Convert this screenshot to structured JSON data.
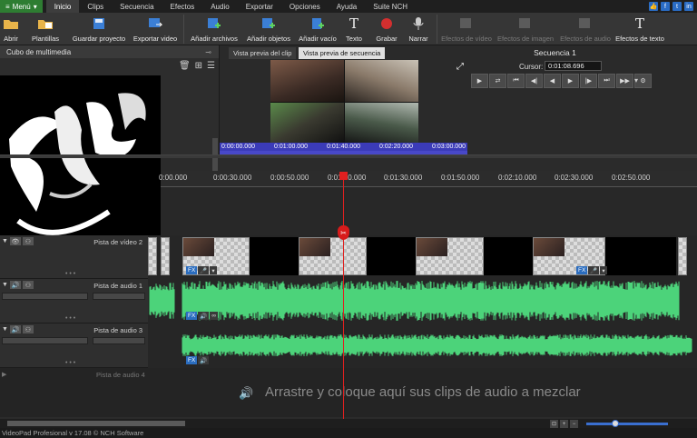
{
  "menubar": {
    "menu_label": "Menú",
    "tabs": [
      {
        "label": "Inicio"
      },
      {
        "label": "Clips"
      },
      {
        "label": "Secuencia"
      },
      {
        "label": "Efectos"
      },
      {
        "label": "Audio"
      },
      {
        "label": "Exportar"
      },
      {
        "label": "Opciones"
      },
      {
        "label": "Ayuda"
      },
      {
        "label": "Suite NCH"
      }
    ],
    "active_tab": "Inicio",
    "social": [
      "like-icon",
      "facebook-icon",
      "twitter-icon",
      "linkedin-icon"
    ]
  },
  "toolbar": {
    "abrir": "Abrir",
    "plantillas": "Plantillas",
    "guardar": "Guardar proyecto",
    "exportar": "Exportar video",
    "anadir_archivos": "Añadir archivos",
    "anadir_objetos": "Añadir objetos",
    "anadir_vacio": "Añadir vacío",
    "texto": "Texto",
    "grabar": "Grabar",
    "narrar": "Narrar",
    "efectos_video": "Efectos de vídeo",
    "efectos_imagen": "Efectos de imagen",
    "efectos_audio": "Efectos de audio",
    "efectos_texto": "Efectos de texto"
  },
  "bin": {
    "title": "Cubo de multimedia"
  },
  "preview": {
    "tab_clip": "Vista previa del clip",
    "tab_seq": "Vista previa de secuencia",
    "ruler": [
      "0:00:00.000",
      "0:01:00.000",
      "0:01:40.000",
      "0:02:20.000",
      "0:03:00.000"
    ]
  },
  "sequence": {
    "title": "Secuencia 1",
    "cursor_label": "Cursor:",
    "cursor_value": "0:01:08.696"
  },
  "timeline": {
    "ticks": [
      "0:00.000",
      "0:00:30.000",
      "0:00:50.000",
      "0:01:10.000",
      "0:01:30.000",
      "0:01:50.000",
      "0:02:10.000",
      "0:02:30.000",
      "0:02:50.000"
    ],
    "tracks": {
      "video2": "Pista de vídeo 2",
      "audio1": "Pista de audio 1",
      "audio3": "Pista de audio 3",
      "audio4": "Pista de audio 4"
    },
    "fx_label": "FX",
    "drop_hint": "Arrastre y coloque aquí sus clips de audio a mezclar",
    "wave_color": "#4cd37a"
  },
  "status": {
    "text": "VideoPad Profesional v 17.08 © NCH Software"
  }
}
